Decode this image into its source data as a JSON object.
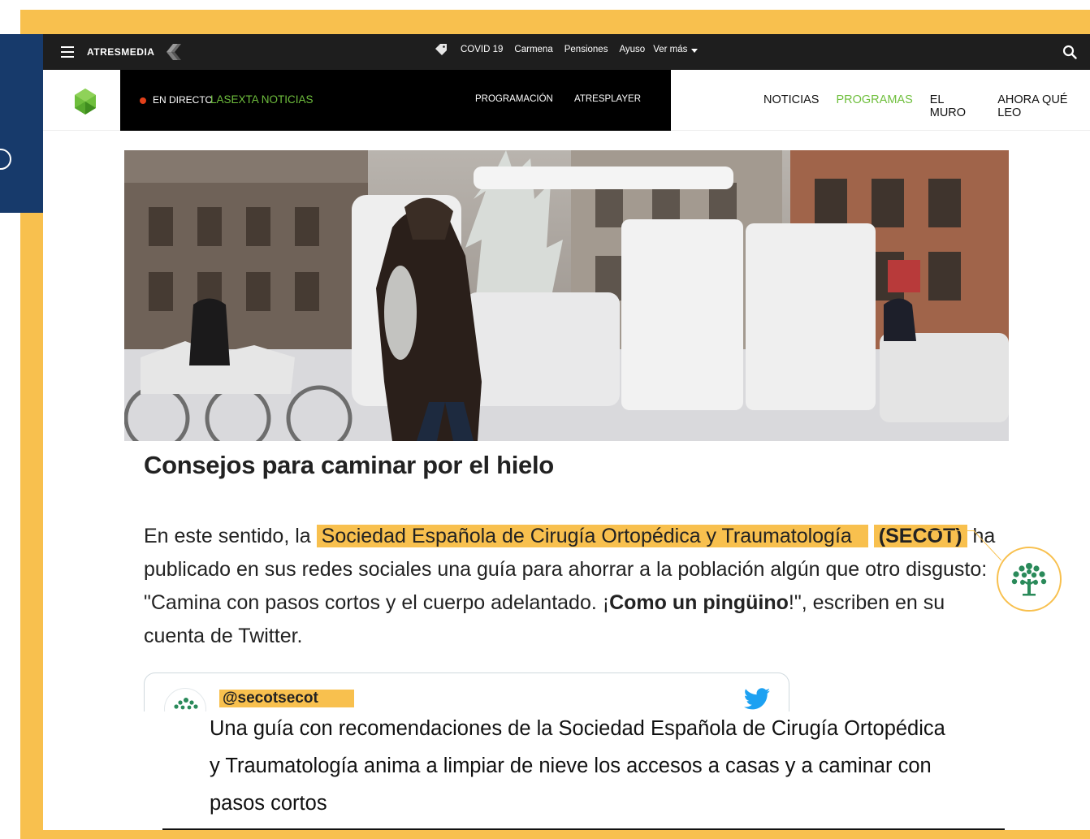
{
  "topbar": {
    "brand": "ATRESMEDIA",
    "trending": [
      "COVID 19",
      "Carmena",
      "Pensiones",
      "Ayuso"
    ],
    "more_label": "Ver más"
  },
  "navbar": {
    "live_label": "EN DIRECTO",
    "live_channel": "LASEXTA NOTICIAS",
    "links": [
      "PROGRAMACIÓN",
      "ATRESPLAYER"
    ],
    "main_nav": [
      "NOTICIAS",
      "PROGRAMAS",
      "EL MURO",
      "AHORA QUÉ LEO"
    ],
    "active_item": "PROGRAMAS"
  },
  "article": {
    "heading": "Consejos para caminar por el hielo",
    "para_intro": "En este sentido, la ",
    "org_name": "Sociedad Española de Cirugía Ortopédica y Traumatología",
    "org_abbr": "(SECOT)",
    "para_mid": " ha publicado en sus redes sociales una guía para ahorrar a la población algún que otro disgusto: \"Camina con pasos cortos y el cuerpo adelantado. ¡",
    "para_bold": "Como un pingüino",
    "para_end": "!\", escriben en su cuenta de Twitter."
  },
  "tweet": {
    "handle": "@secotsecot"
  },
  "caption": "Una guía con recomendaciones de la Sociedad Española de Cirugía Ortopédica y Traumatología anima a limpiar de nieve los accesos a casas y a caminar con pasos cortos",
  "colors": {
    "accent": "#f8c04e",
    "live_green": "#6fbf3d",
    "live_dot": "#e2401a",
    "side_panel": "#173a6b",
    "twitter": "#1da1f2",
    "secot_green": "#2a8a5a"
  }
}
